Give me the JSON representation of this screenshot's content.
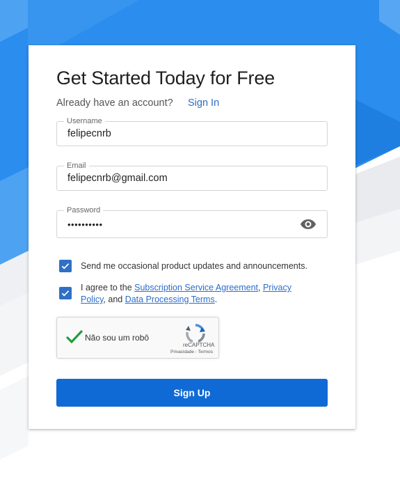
{
  "page": {
    "title": "Get Started Today for Free",
    "already_account": "Already have an account?",
    "sign_in": "Sign In"
  },
  "fields": {
    "username": {
      "label": "Username",
      "value": "felipecnrb"
    },
    "email": {
      "label": "Email",
      "value": "felipecnrb@gmail.com"
    },
    "password": {
      "label": "Password",
      "value": "••••••••••",
      "icon": "eye-icon"
    }
  },
  "checkboxes": {
    "updates": {
      "checked": true,
      "label": "Send me occasional product updates and announcements."
    },
    "agree": {
      "checked": true,
      "prefix": "I agree to the ",
      "link1": "Subscription Service Agreement",
      "sep1": ", ",
      "link2": "Privacy Policy",
      "sep2": ", and ",
      "link3": "Data Processing Terms",
      "suffix": "."
    }
  },
  "recaptcha": {
    "label": "Não sou um robô",
    "brand": "reCAPTCHA",
    "privacy": "Privacidade",
    "separator": " - ",
    "terms": "Termos"
  },
  "actions": {
    "signup_label": "Sign Up"
  },
  "colors": {
    "primary": "#0f6ad6",
    "link": "#2b6dc9",
    "checkbox": "#2f6fc5",
    "background_blue": "#2a8def",
    "recaptcha_check": "#1e9e3e"
  }
}
